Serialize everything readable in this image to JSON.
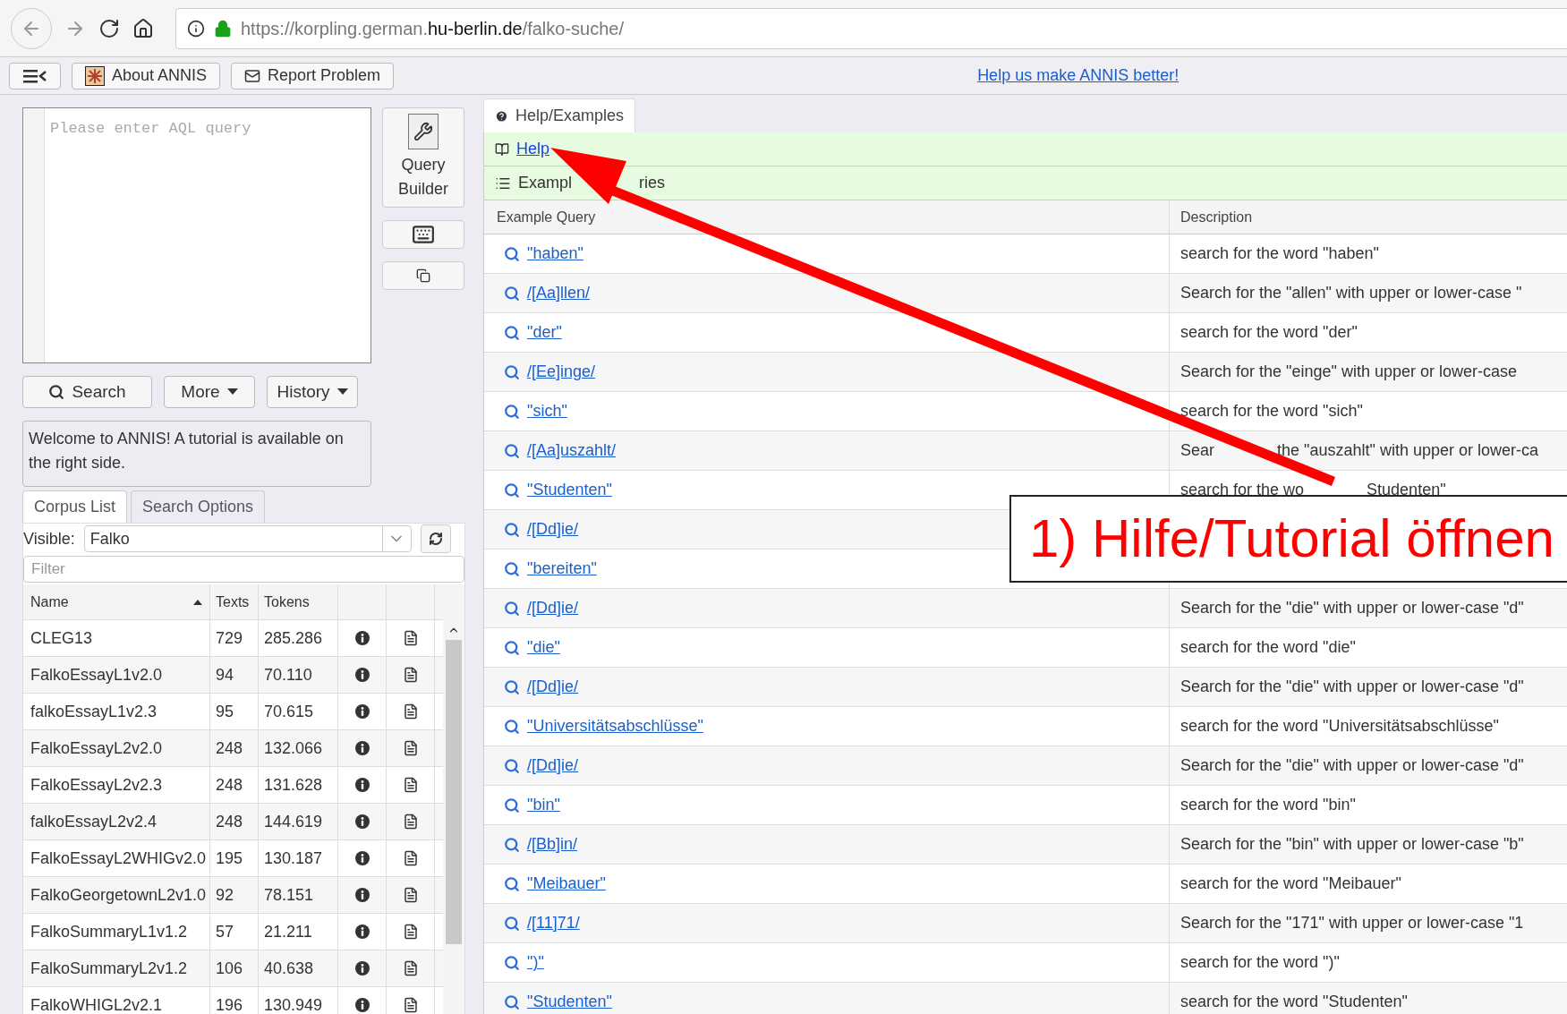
{
  "browser": {
    "url_parts": [
      {
        "text": "https://korpling.german.",
        "strong": false
      },
      {
        "text": "hu-berlin.de",
        "strong": true
      },
      {
        "text": "/falko-suche/",
        "strong": false
      }
    ]
  },
  "toolbar": {
    "buttons": [
      {
        "label": "About ANNIS",
        "kind": "logo"
      },
      {
        "label": "Report Problem",
        "kind": "mail"
      }
    ],
    "link": "Help us make ANNIS better!"
  },
  "query": {
    "placeholder": "Please enter AQL query",
    "builder": "Query Builder"
  },
  "actions": [
    {
      "label": "Search",
      "kind": "search"
    },
    {
      "label": "More",
      "kind": "dropdown"
    },
    {
      "label": "History",
      "kind": "dropdown"
    }
  ],
  "welcome": "Welcome to ANNIS! A tutorial is available on the right side.",
  "left_tabs": [
    {
      "label": "Corpus List",
      "selected": true
    },
    {
      "label": "Search Options",
      "selected": false
    }
  ],
  "visible": {
    "label": "Visible:",
    "value": "Falko"
  },
  "filter": {
    "placeholder": "Filter"
  },
  "corpus_table": {
    "columns": [
      "Name",
      "Texts",
      "Tokens"
    ],
    "rows": [
      {
        "name": "CLEG13",
        "texts": "729",
        "tokens": "285.286"
      },
      {
        "name": "FalkoEssayL1v2.0",
        "texts": "94",
        "tokens": "70.110"
      },
      {
        "name": "falkoEssayL1v2.3",
        "texts": "95",
        "tokens": "70.615"
      },
      {
        "name": "FalkoEssayL2v2.0",
        "texts": "248",
        "tokens": "132.066"
      },
      {
        "name": "FalkoEssayL2v2.3",
        "texts": "248",
        "tokens": "131.628"
      },
      {
        "name": "falkoEssayL2v2.4",
        "texts": "248",
        "tokens": "144.619"
      },
      {
        "name": "FalkoEssayL2WHIGv2.0",
        "texts": "195",
        "tokens": "130.187"
      },
      {
        "name": "FalkoGeorgetownL2v1.0",
        "texts": "92",
        "tokens": "78.151"
      },
      {
        "name": "FalkoSummaryL1v1.2",
        "texts": "57",
        "tokens": "21.211"
      },
      {
        "name": "FalkoSummaryL2v1.2",
        "texts": "106",
        "tokens": "40.638"
      },
      {
        "name": "FalkoWHIGL2v2.1",
        "texts": "196",
        "tokens": "130.949"
      }
    ]
  },
  "right_tab": {
    "label": "Help/Examples"
  },
  "help_items": [
    {
      "label": "Help",
      "kind": "link"
    },
    {
      "parts": [
        "Exampl",
        "ries"
      ],
      "kind": "plain"
    }
  ],
  "examples": {
    "columns": [
      "Example Query",
      "Description"
    ],
    "rows": [
      {
        "query": "\"haben\"",
        "description": "search for the word \"haben\""
      },
      {
        "query": "/[Aa]llen/",
        "description": "Search for the \"allen\" with upper or lower-case \""
      },
      {
        "query": "\"der\"",
        "description": "search for the word \"der\""
      },
      {
        "query": "/[Ee]inge/",
        "description": "Search for the \"einge\" with upper or lower-case"
      },
      {
        "query": "\"sich\"",
        "description": "search for the word \"sich\""
      },
      {
        "query": "/[Aa]uszahlt/",
        "description_parts": [
          "Sear",
          "the \"auszahlt\" with upper or lower-ca"
        ]
      },
      {
        "query": "\"Studenten\"",
        "description_parts": [
          "search for the wo",
          "Studenten\""
        ]
      },
      {
        "query": "/[Dd]ie/"
      },
      {
        "query": "\"bereiten\""
      },
      {
        "query": "/[Dd]ie/",
        "description": "Search for the \"die\" with upper or lower-case \"d\""
      },
      {
        "query": "\"die\"",
        "description": "search for the word \"die\""
      },
      {
        "query": "/[Dd]ie/",
        "description": "Search for the \"die\" with upper or lower-case \"d\""
      },
      {
        "query": "\"Universitätsabschlüsse\"",
        "description": "search for the word \"Universitätsabschlüsse\""
      },
      {
        "query": "/[Dd]ie/",
        "description": "Search for the \"die\" with upper or lower-case \"d\""
      },
      {
        "query": "\"bin\"",
        "description": "search for the word \"bin\""
      },
      {
        "query": "/[Bb]in/",
        "description": "Search for the \"bin\" with upper or lower-case \"b\""
      },
      {
        "query": "\"Meibauer\"",
        "description": "search for the word \"Meibauer\""
      },
      {
        "query": "/[11]71/",
        "description": "Search for the \"171\" with upper or lower-case \"1"
      },
      {
        "query": "\")\"",
        "description": "search for the word \")\""
      },
      {
        "query": "\"Studenten\"",
        "description": "search for the word \"Studenten\""
      }
    ]
  },
  "annotation": {
    "text": "1) Hilfe/Tutorial öffnen"
  }
}
